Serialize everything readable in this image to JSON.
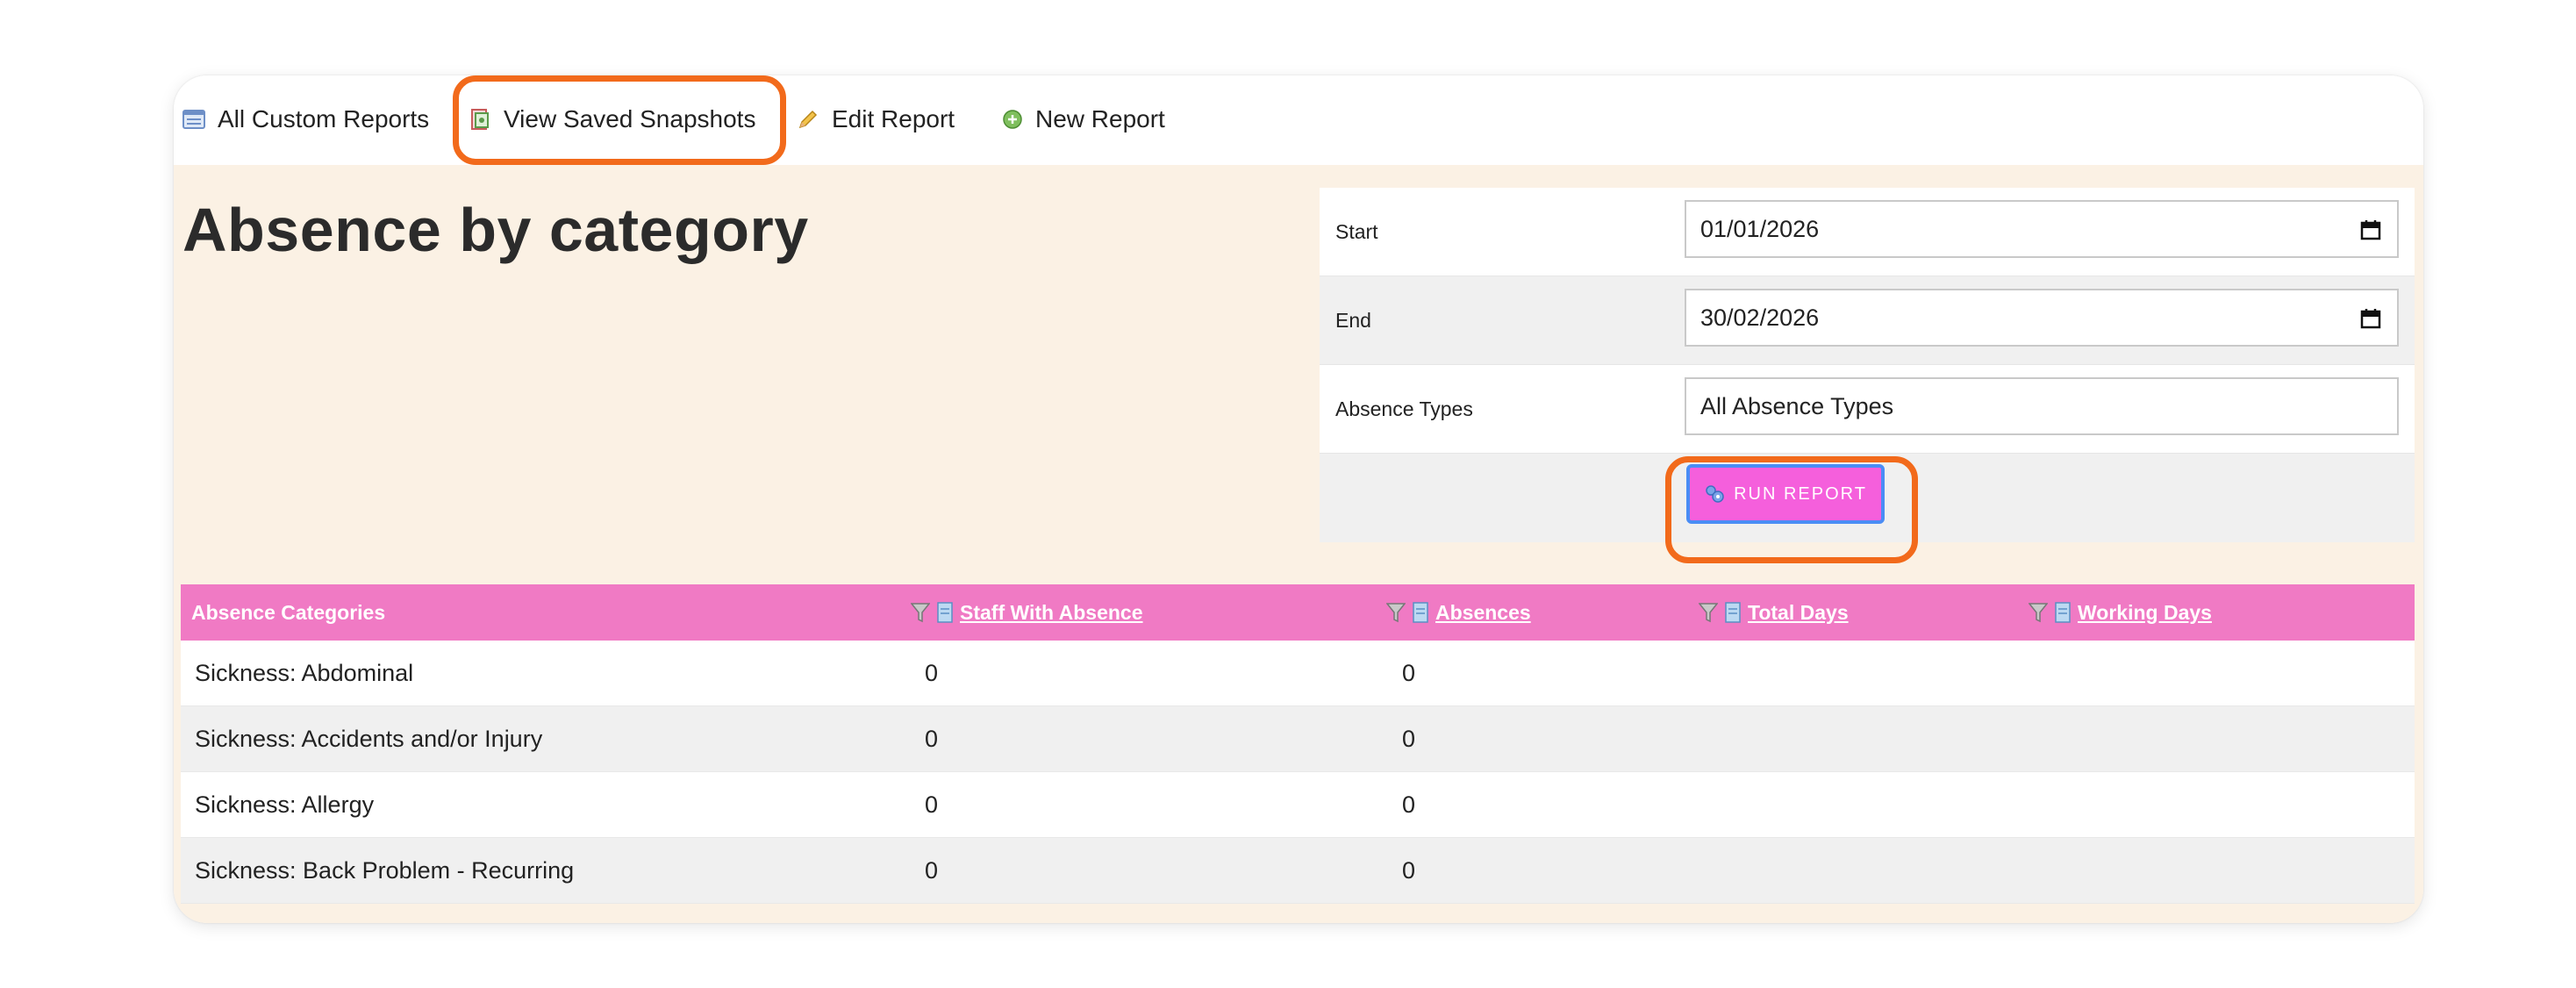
{
  "toolbar": {
    "items": [
      {
        "label": "All Custom Reports",
        "icon": "report-list-icon"
      },
      {
        "label": "View Saved Snapshots",
        "icon": "snapshot-icon"
      },
      {
        "label": "Edit Report",
        "icon": "pencil-icon"
      },
      {
        "label": "New Report",
        "icon": "add-icon"
      }
    ]
  },
  "page": {
    "title": "Absence by category"
  },
  "filters": {
    "start": {
      "label": "Start",
      "value": "01/01/2026"
    },
    "end": {
      "label": "End",
      "value": "30/02/2026"
    },
    "absence_types": {
      "label": "Absence Types",
      "value": "All Absence Types"
    },
    "run_label": "RUN REPORT"
  },
  "table": {
    "columns": [
      "Absence Categories",
      "Staff With Absence",
      "Absences",
      "Total Days",
      "Working Days"
    ],
    "rows": [
      {
        "category": "Sickness: Abdominal",
        "staff": "0",
        "absences": "0"
      },
      {
        "category": "Sickness: Accidents and/or Injury",
        "staff": "0",
        "absences": "0"
      },
      {
        "category": "Sickness: Allergy",
        "staff": "0",
        "absences": "0"
      },
      {
        "category": "Sickness: Back Problem - Recurring",
        "staff": "0",
        "absences": "0"
      }
    ]
  },
  "colors": {
    "accent_pink": "#f07ac4",
    "button_pink": "#f55fdc",
    "highlight_orange": "#f26a1b",
    "panel_cream": "#fbf1e4"
  }
}
